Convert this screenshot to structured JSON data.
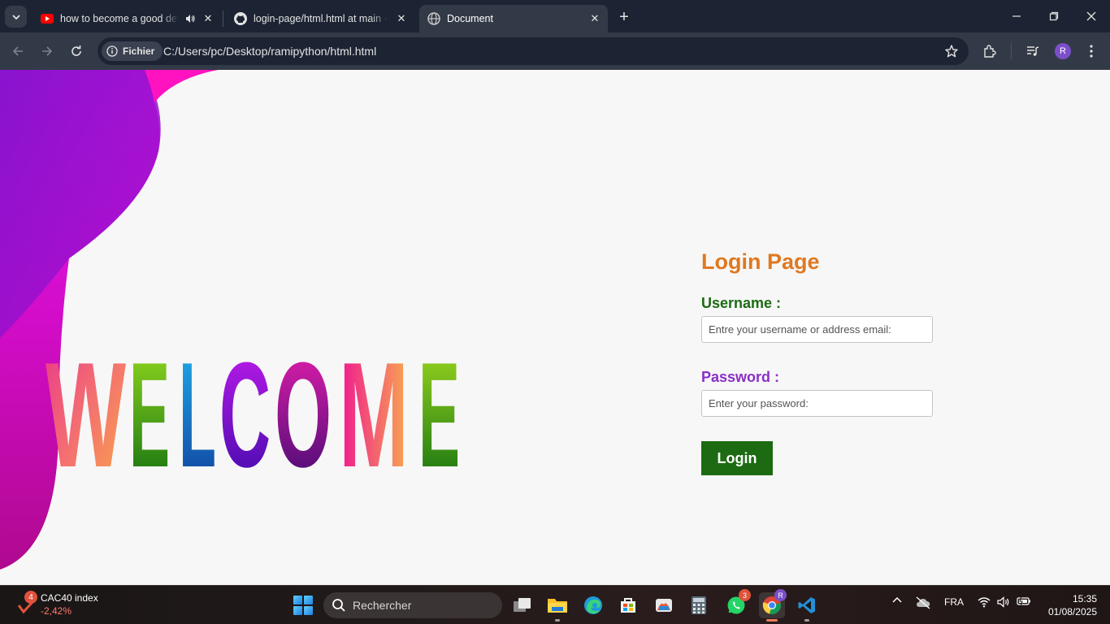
{
  "browser": {
    "tabs": [
      {
        "title": "how to become a good dev",
        "favicon": "youtube-icon",
        "audio": true
      },
      {
        "title": "login-page/html.html at main · ",
        "favicon": "github-icon"
      },
      {
        "title": "Document",
        "favicon": "globe-icon",
        "active": true
      }
    ],
    "address": {
      "chip_label": "Fichier",
      "url": "C:/Users/pc/Desktop/ramipython/html.html"
    },
    "profile_initial": "R"
  },
  "page": {
    "welcome_text": "WELCOME",
    "login_title": "Login Page",
    "username_label": "Username :",
    "username_placeholder": "Entre your username or address email:",
    "password_label": "Password :",
    "password_placeholder": "Enter your password:",
    "login_button": "Login",
    "colors": {
      "title": "#e07820",
      "username_label": "#1c6b12",
      "password_label": "#8a2fc8",
      "button": "#1c6b12"
    }
  },
  "taskbar": {
    "widget": {
      "name": "CAC40 index",
      "value": "-2,42%",
      "badge": "4"
    },
    "search_placeholder": "Rechercher",
    "whatsapp_badge": "3",
    "language": "FRA",
    "time": "15:35",
    "date": "01/08/2025"
  }
}
